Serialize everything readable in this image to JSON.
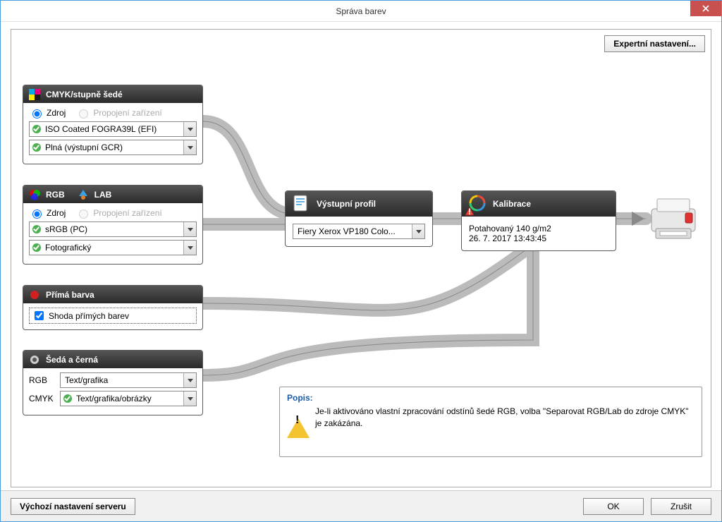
{
  "window": {
    "title": "Správa barev"
  },
  "buttons": {
    "expert": "Expertní nastavení...",
    "defaults": "Výchozí nastavení serveru",
    "ok": "OK",
    "cancel": "Zrušit"
  },
  "cmyk_panel": {
    "title": "CMYK/stupně šedé",
    "radio_source": "Zdroj",
    "radio_link": "Propojení zařízení",
    "profile": "ISO Coated FOGRA39L (EFI)",
    "intent": "Plná (výstupní GCR)"
  },
  "rgb_panel": {
    "title_rgb": "RGB",
    "title_lab": "LAB",
    "radio_source": "Zdroj",
    "radio_link": "Propojení zařízení",
    "profile": "sRGB (PC)",
    "intent": "Fotografický"
  },
  "spot_panel": {
    "title": "Přímá barva",
    "checkbox_label": "Shoda přímých barev"
  },
  "gray_panel": {
    "title": "Šedá a černá",
    "rgb_label": "RGB",
    "cmyk_label": "CMYK",
    "rgb_value": "Text/grafika",
    "cmyk_value": "Text/grafika/obrázky"
  },
  "output_panel": {
    "title": "Výstupní profil",
    "value": "Fiery Xerox VP180 Colo..."
  },
  "calib_panel": {
    "title": "Kalibrace",
    "line1": "Potahovaný 140 g/m2",
    "line2": "26. 7. 2017 13:43:45"
  },
  "description": {
    "title": "Popis:",
    "text": "Je-li aktivováno vlastní zpracování odstínů šedé RGB, volba \"Separovat RGB/Lab do zdroje CMYK\" je zakázána."
  }
}
